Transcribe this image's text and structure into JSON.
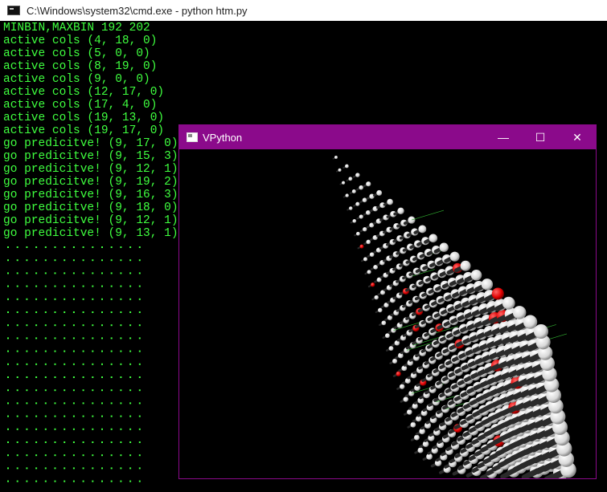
{
  "cmd": {
    "title": "C:\\Windows\\system32\\cmd.exe - python  htm.py",
    "lines": [
      "MINBIN,MAXBIN 192 202",
      "active cols (4, 18, 0)",
      "active cols (5, 0, 0)",
      "active cols (8, 19, 0)",
      "active cols (9, 0, 0)",
      "active cols (12, 17, 0)",
      "active cols (17, 4, 0)",
      "active cols (19, 13, 0)",
      "active cols (19, 17, 0)",
      "go predicitve! (9, 17, 0)",
      "go predicitve! (9, 15, 3)",
      "go predicitve! (9, 12, 1)",
      "go predicitve! (9, 19, 2)",
      "go predicitve! (9, 16, 3)",
      "go predicitve! (9, 18, 0)",
      "go predicitve! (9, 12, 1)",
      "go predicitve! (9, 13, 1)"
    ],
    "text_color": "#3fff3f"
  },
  "vpython": {
    "title": "VPython",
    "controls": {
      "minimize": "—",
      "maximize": "☐",
      "close": "✕"
    },
    "accent": "#8b0a8b"
  }
}
